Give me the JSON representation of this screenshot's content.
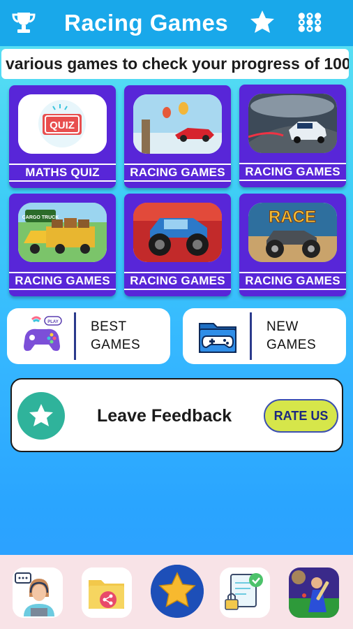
{
  "header": {
    "title": "Racing Games",
    "icons": [
      "trophy-icon",
      "star-icon",
      "grid-dots-icon"
    ],
    "color": "#19a8ea"
  },
  "marquee": {
    "text": "various games to check your progress of 100"
  },
  "tiles": [
    {
      "label": "MATHS QUIZ",
      "image": "quiz-image"
    },
    {
      "label": "RACING GAMES",
      "image": "balloon-car-image"
    },
    {
      "label": "RACING GAMES",
      "image": "police-car-image"
    },
    {
      "label": "RACING GAMES",
      "image": "cargo-truck-image"
    },
    {
      "label": "RACING GAMES",
      "image": "monster-truck-image"
    },
    {
      "label": "RACING GAMES",
      "image": "race-monster-truck-image"
    }
  ],
  "quiz_word": "QUIZ",
  "race_word": "RACE",
  "truck_sign": "CARGO TRUCK",
  "categories": {
    "best": {
      "line1": "BEST",
      "line2": "GAMES",
      "badge": "PLAY"
    },
    "new": {
      "line1": "NEW",
      "line2": "GAMES"
    }
  },
  "feedback": {
    "text": "Leave Feedback",
    "button": "RATE US"
  },
  "bottom_nav": [
    "support-agent-icon",
    "share-folder-icon",
    "star-icon",
    "secure-document-icon",
    "cricket-game-icon"
  ],
  "colors": {
    "tile": "#5826d8",
    "accent_green": "#2fb39b",
    "rate_button": "#d6e64a"
  }
}
